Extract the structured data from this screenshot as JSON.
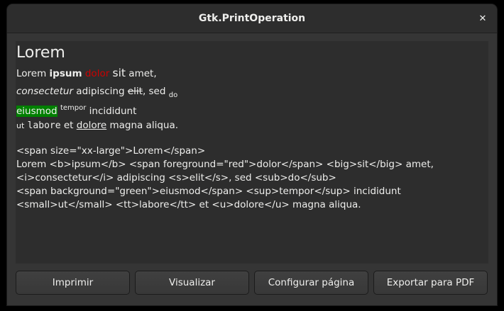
{
  "window": {
    "title": "Gtk.PrintOperation"
  },
  "icons": {
    "close": "close-icon"
  },
  "rendered": {
    "title": "Lorem",
    "line1": {
      "a": "Lorem ",
      "b": "ipsum",
      "c": " ",
      "red": "dolor",
      "d": " ",
      "big": "sit",
      "e": " amet,"
    },
    "line2": {
      "i": "consectetur",
      "a": " adipiscing ",
      "s": "elit",
      "b": ", sed ",
      "sub": "do"
    },
    "line3": {
      "green": "eiusmod",
      "a": " ",
      "sup": "tempor",
      "b": " incididunt"
    },
    "line4": {
      "small": "ut",
      "a": " ",
      "tt": "labore",
      "b": " et ",
      "u": "dolore",
      "c": " magna aliqua."
    }
  },
  "markup_lines": [
    "<span size=\"xx-large\">Lorem</span>",
    "Lorem <b>ipsum</b> <span foreground=\"red\">dolor</span> <big>sit</big> amet,",
    "<i>consectetur</i> adipiscing <s>elit</s>, sed <sub>do</sub>",
    "<span background=\"green\">eiusmod</span> <sup>tempor</sup> incididunt",
    "<small>ut</small> <tt>labore</tt> et <u>dolore</u> magna aliqua."
  ],
  "buttons": {
    "print": "Imprimir",
    "preview": "Visualizar",
    "page_setup": "Configurar página",
    "export_pdf": "Exportar para PDF"
  }
}
